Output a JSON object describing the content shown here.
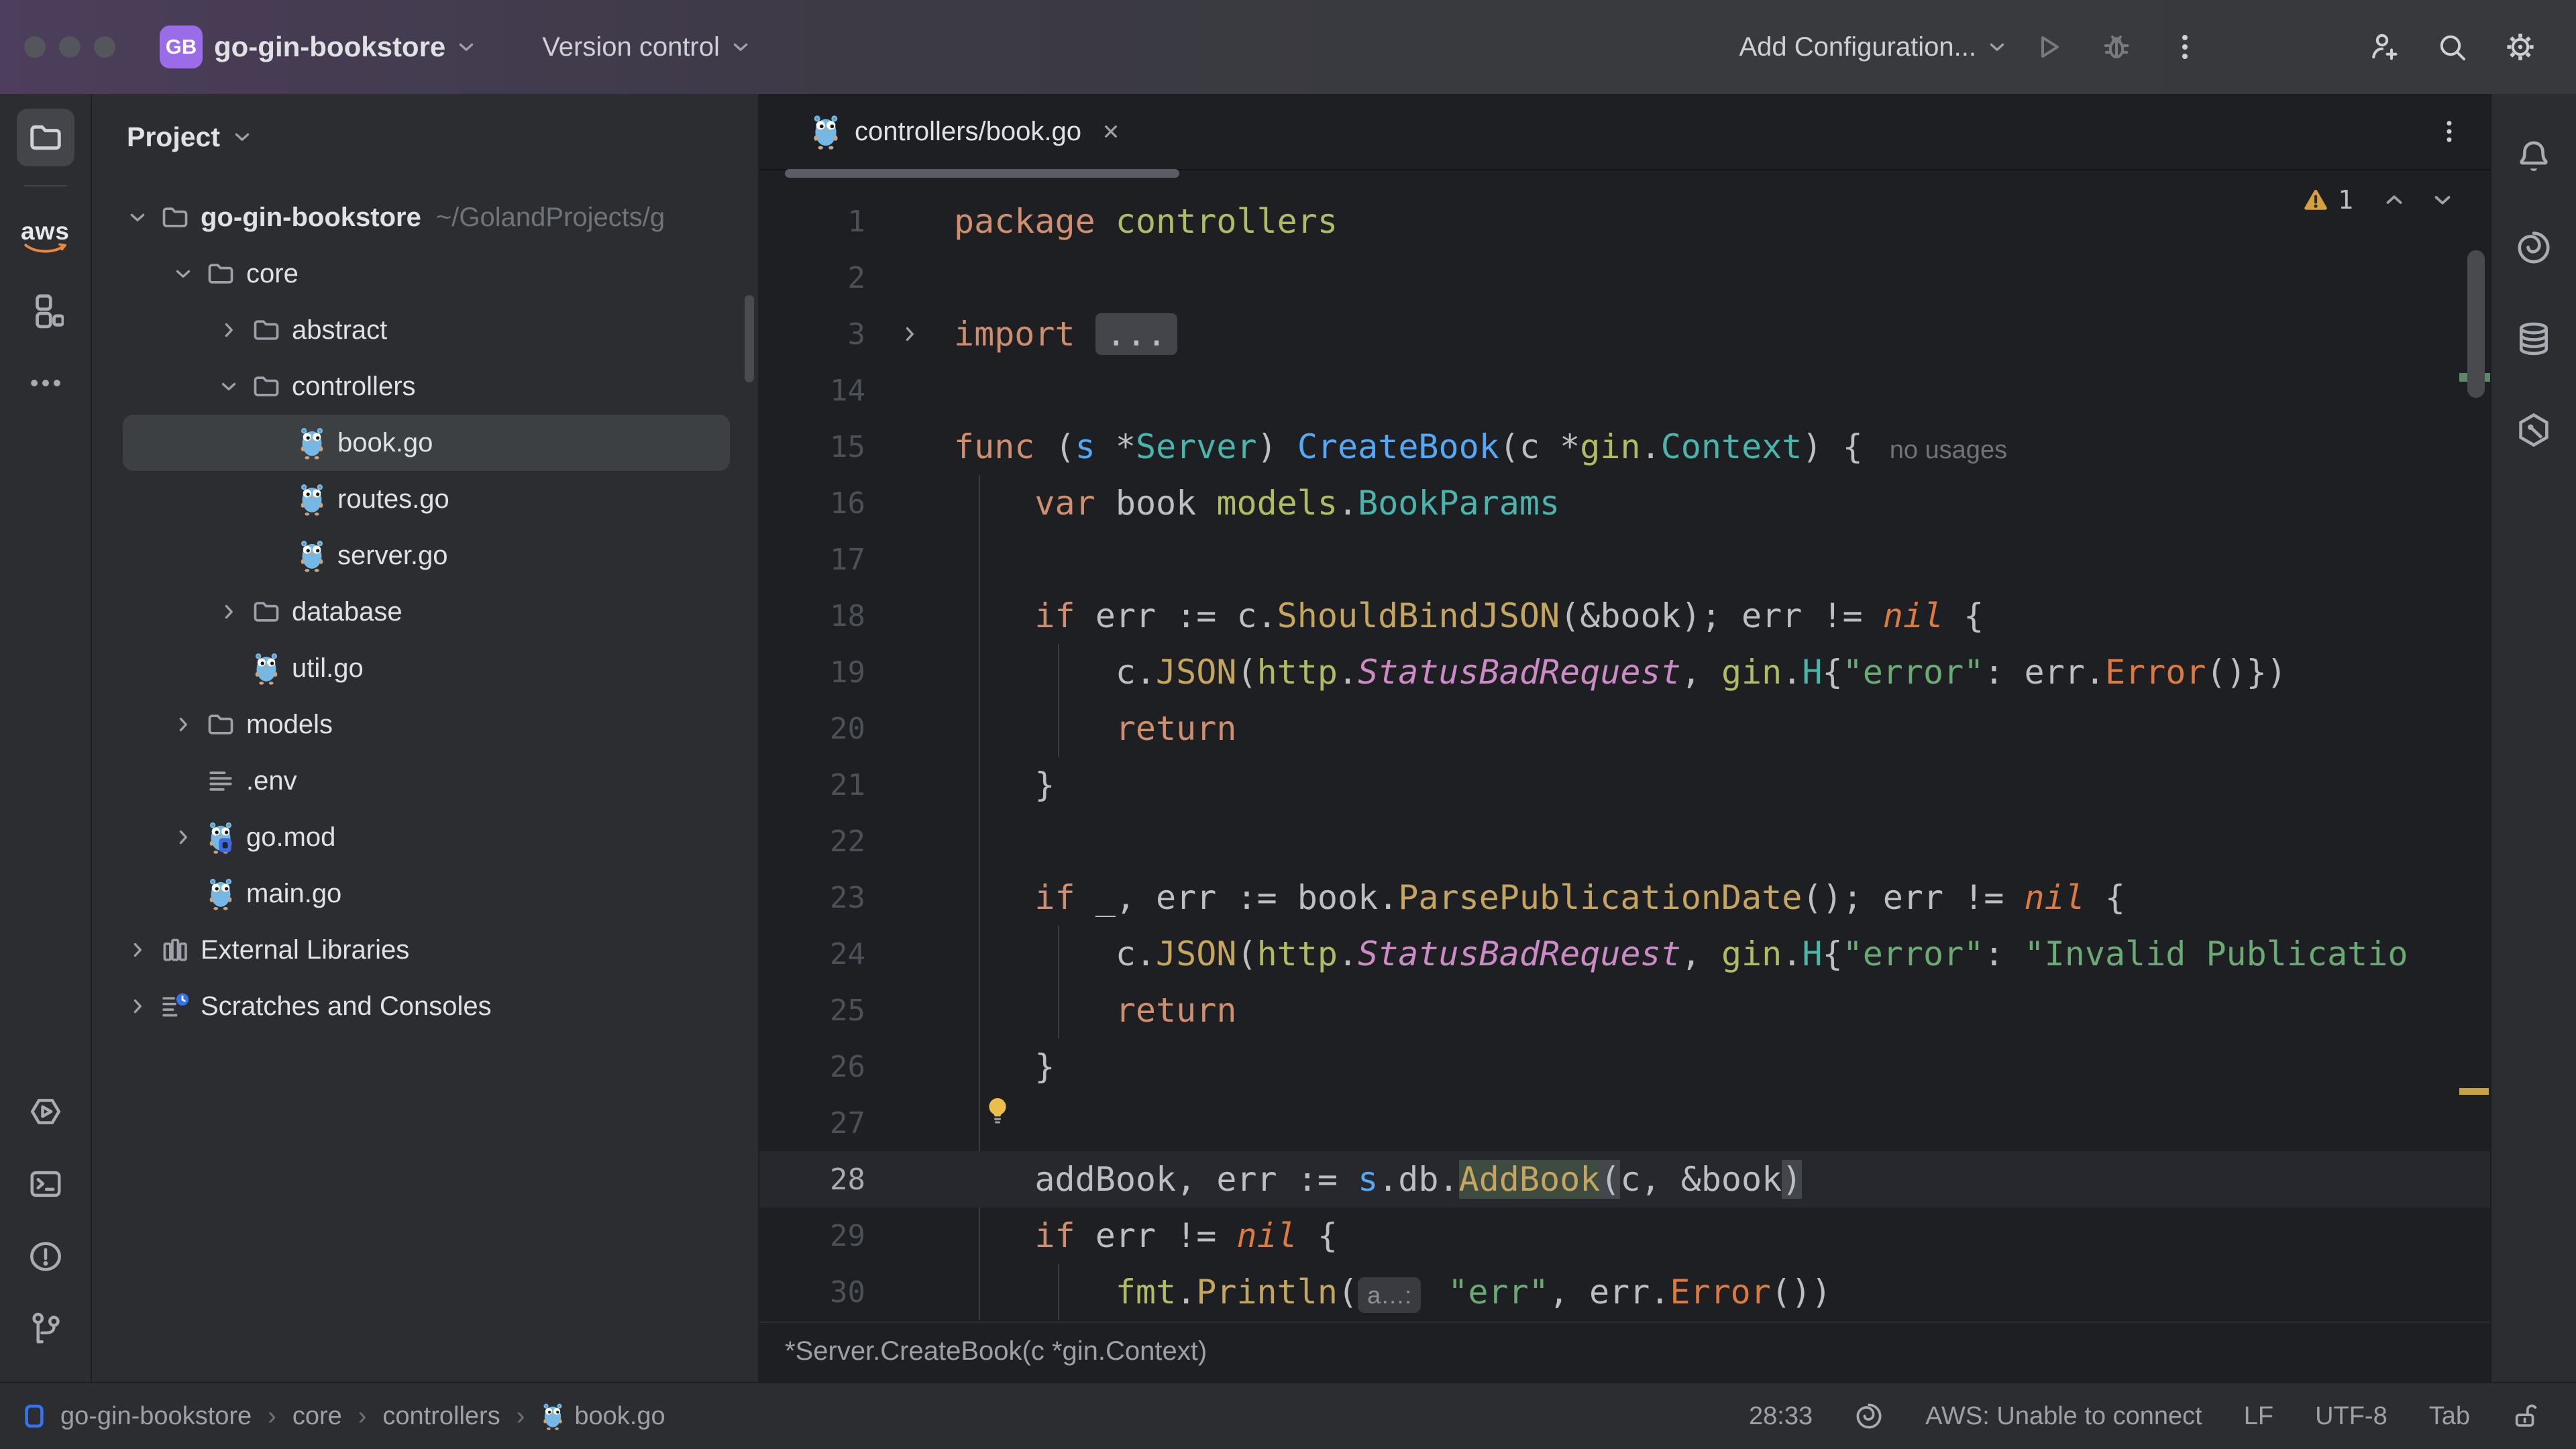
{
  "colors": {
    "accent_purple": "#9A6CE8",
    "panel_bg": "#2B2D30",
    "editor_bg": "#1E1F22",
    "warning": "#D6A03C",
    "selection_row": "#3D4043",
    "caret_line": "#26282E",
    "aws_orange": "#E8883C",
    "status_blue": "#3574F0"
  },
  "titlebar": {
    "project_badge": "GB",
    "project_name": "go-gin-bookstore",
    "menu_label": "Version control",
    "run_config_label": "Add Configuration...",
    "right_icons": [
      {
        "icon": "play",
        "name": "run-button",
        "dim": true
      },
      {
        "icon": "bug",
        "name": "debug-button",
        "dim": true
      },
      {
        "icon": "kebab",
        "name": "more-actions-button",
        "dim": false
      },
      {
        "gap": true
      },
      {
        "icon": "user-plus",
        "name": "code-with-me-button",
        "dim": false
      },
      {
        "icon": "search",
        "name": "search-everywhere-button",
        "dim": false
      },
      {
        "icon": "gear",
        "name": "settings-button",
        "dim": false
      }
    ]
  },
  "activity_bar": {
    "top": [
      {
        "icon": "project-folder",
        "name": "project-tool-button",
        "active": true
      },
      {
        "divider": true
      },
      {
        "icon": "aws-logo",
        "name": "aws-tool-button"
      },
      {
        "icon": "structure",
        "name": "structure-tool-button"
      },
      {
        "icon": "more-dots",
        "name": "more-tool-windows-button"
      }
    ],
    "bottom": [
      {
        "icon": "services-play",
        "name": "services-tool-button"
      },
      {
        "icon": "terminal",
        "name": "terminal-tool-button"
      },
      {
        "icon": "problems",
        "name": "problems-tool-button"
      },
      {
        "icon": "git-branch",
        "name": "git-tool-button"
      }
    ]
  },
  "project_panel": {
    "header": "Project",
    "tree": [
      {
        "label": "go-gin-bookstore",
        "suffix": "~/GolandProjects/g",
        "level": 0,
        "chevron": "down",
        "icon": "folder",
        "bold": true
      },
      {
        "label": "core",
        "level": 1,
        "chevron": "down",
        "icon": "folder"
      },
      {
        "label": "abstract",
        "level": 2,
        "chevron": "right",
        "icon": "folder"
      },
      {
        "label": "controllers",
        "level": 2,
        "chevron": "down",
        "icon": "folder"
      },
      {
        "label": "book.go",
        "level": 3,
        "chevron": "none",
        "icon": "gopher",
        "selected": true
      },
      {
        "label": "routes.go",
        "level": 3,
        "chevron": "none",
        "icon": "gopher"
      },
      {
        "label": "server.go",
        "level": 3,
        "chevron": "none",
        "icon": "gopher"
      },
      {
        "label": "database",
        "level": 2,
        "chevron": "right",
        "icon": "folder"
      },
      {
        "label": "util.go",
        "level": 2,
        "chevron": "none",
        "icon": "gopher"
      },
      {
        "label": "models",
        "level": 1,
        "chevron": "right",
        "icon": "folder"
      },
      {
        "label": ".env",
        "level": 1,
        "chevron": "none",
        "icon": "envfile"
      },
      {
        "label": "go.mod",
        "level": 1,
        "chevron": "right",
        "icon": "gomod"
      },
      {
        "label": "main.go",
        "level": 1,
        "chevron": "none",
        "icon": "gopher"
      },
      {
        "label": "External Libraries",
        "level": 0,
        "chevron": "right",
        "icon": "extlib"
      },
      {
        "label": "Scratches and Consoles",
        "level": 0,
        "chevron": "right",
        "icon": "scratches"
      }
    ]
  },
  "editor": {
    "tab": {
      "label": "controllers/book.go"
    },
    "inspections": {
      "warning_count": "1"
    },
    "breadcrumb_doc": "*Server.CreateBook(c *gin.Context)",
    "code": {
      "lines": [
        {
          "n": "1",
          "seg": [
            [
              "kw",
              "package"
            ],
            [
              "t",
              " "
            ],
            [
              "pkg",
              "controllers"
            ]
          ]
        },
        {
          "n": "2",
          "seg": []
        },
        {
          "n": "3",
          "fold": true,
          "seg": [
            [
              "kw",
              "import"
            ],
            [
              "t",
              " "
            ],
            [
              "foldbox",
              "..."
            ]
          ]
        },
        {
          "n": "14",
          "seg": []
        },
        {
          "n": "15",
          "seg": [
            [
              "kw",
              "func"
            ],
            [
              "t",
              " ("
            ],
            [
              "param",
              "s"
            ],
            [
              "t",
              " *"
            ],
            [
              "type",
              "Server"
            ],
            [
              "t",
              ") "
            ],
            [
              "fndecl",
              "CreateBook"
            ],
            [
              "t",
              "(c *"
            ],
            [
              "pkg",
              "gin"
            ],
            [
              "t",
              "."
            ],
            [
              "type",
              "Context"
            ],
            [
              "t",
              ") {"
            ],
            [
              "inlay",
              "no usages"
            ]
          ]
        },
        {
          "n": "16",
          "seg": [
            [
              "t",
              "    "
            ],
            [
              "kw",
              "var"
            ],
            [
              "t",
              " book "
            ],
            [
              "pkg",
              "models"
            ],
            [
              "t",
              "."
            ],
            [
              "type",
              "BookParams"
            ]
          ]
        },
        {
          "n": "17",
          "seg": []
        },
        {
          "n": "18",
          "seg": [
            [
              "t",
              "    "
            ],
            [
              "kw",
              "if"
            ],
            [
              "t",
              " err := c."
            ],
            [
              "fncall",
              "ShouldBindJSON"
            ],
            [
              "t",
              "(&book); err != "
            ],
            [
              "builtin",
              "nil"
            ],
            [
              "t",
              " {"
            ]
          ]
        },
        {
          "n": "19",
          "seg": [
            [
              "t",
              "        c."
            ],
            [
              "fncall",
              "JSON"
            ],
            [
              "t",
              "("
            ],
            [
              "pkg",
              "http"
            ],
            [
              "t",
              "."
            ],
            [
              "const",
              "StatusBadRequest"
            ],
            [
              "t",
              ", "
            ],
            [
              "pkg",
              "gin"
            ],
            [
              "t",
              "."
            ],
            [
              "type",
              "H"
            ],
            [
              "t",
              "{"
            ],
            [
              "str",
              "\"error\""
            ],
            [
              "t",
              ": err."
            ],
            [
              "builtin2",
              "Error"
            ],
            [
              "t",
              "()})"
            ]
          ]
        },
        {
          "n": "20",
          "seg": [
            [
              "t",
              "        "
            ],
            [
              "kw",
              "return"
            ]
          ]
        },
        {
          "n": "21",
          "seg": [
            [
              "t",
              "    }"
            ]
          ]
        },
        {
          "n": "22",
          "seg": []
        },
        {
          "n": "23",
          "seg": [
            [
              "t",
              "    "
            ],
            [
              "kw",
              "if"
            ],
            [
              "t",
              " _, err := book."
            ],
            [
              "fncall",
              "ParsePublicationDate"
            ],
            [
              "t",
              "(); err != "
            ],
            [
              "builtin",
              "nil"
            ],
            [
              "t",
              " {"
            ]
          ]
        },
        {
          "n": "24",
          "seg": [
            [
              "t",
              "        c."
            ],
            [
              "fncall",
              "JSON"
            ],
            [
              "t",
              "("
            ],
            [
              "pkg",
              "http"
            ],
            [
              "t",
              "."
            ],
            [
              "const",
              "StatusBadRequest"
            ],
            [
              "t",
              ", "
            ],
            [
              "pkg",
              "gin"
            ],
            [
              "t",
              "."
            ],
            [
              "type",
              "H"
            ],
            [
              "t",
              "{"
            ],
            [
              "str",
              "\"error\""
            ],
            [
              "t",
              ": "
            ],
            [
              "str",
              "\"Invalid Publicatio"
            ]
          ]
        },
        {
          "n": "25",
          "seg": [
            [
              "t",
              "        "
            ],
            [
              "kw",
              "return"
            ]
          ]
        },
        {
          "n": "26",
          "seg": [
            [
              "t",
              "    }"
            ]
          ]
        },
        {
          "n": "27",
          "seg": []
        },
        {
          "n": "28",
          "caret": true,
          "seg": [
            [
              "t",
              "    addBook, err := "
            ],
            [
              "param",
              "s"
            ],
            [
              "t",
              ".db."
            ],
            [
              "hl",
              "AddBook"
            ],
            [
              "brace",
              "("
            ],
            [
              "t",
              "c, &book"
            ],
            [
              "brace",
              ")"
            ]
          ]
        },
        {
          "n": "29",
          "seg": [
            [
              "t",
              "    "
            ],
            [
              "kw",
              "if"
            ],
            [
              "t",
              " err != "
            ],
            [
              "builtin",
              "nil"
            ],
            [
              "t",
              " {"
            ]
          ]
        },
        {
          "n": "30",
          "seg": [
            [
              "t",
              "        "
            ],
            [
              "pkg",
              "fmt"
            ],
            [
              "t",
              "."
            ],
            [
              "fncall",
              "Println"
            ],
            [
              "t",
              "("
            ],
            [
              "chip",
              "a…:"
            ],
            [
              "t",
              " "
            ],
            [
              "str",
              "\"err\""
            ],
            [
              "t",
              ", err."
            ],
            [
              "builtin2",
              "Error"
            ],
            [
              "t",
              "())"
            ]
          ]
        }
      ]
    }
  },
  "right_strip": [
    {
      "icon": "bell",
      "name": "notifications-button"
    },
    {
      "icon": "ai-spiral",
      "name": "ai-assistant-button"
    },
    {
      "icon": "database",
      "name": "database-button"
    },
    {
      "icon": "hexagon-line",
      "name": "codewhisperer-button"
    }
  ],
  "status_bar": {
    "crumbs": [
      "go-gin-bookstore",
      "core",
      "controllers",
      "book.go"
    ],
    "position": "28:33",
    "aws_status": "AWS: Unable to connect",
    "line_separator": "LF",
    "encoding": "UTF-8",
    "indent": "Tab"
  }
}
